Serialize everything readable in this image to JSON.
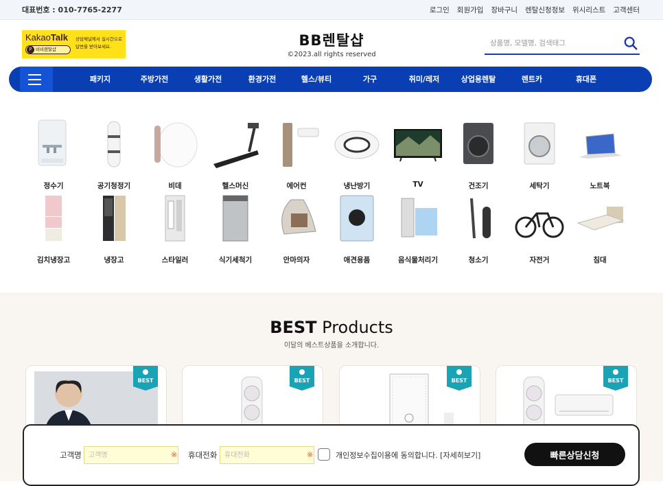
{
  "topbar": {
    "phone": "대표번호 : 010-7765-2277",
    "links": [
      "로그인",
      "회원가입",
      "장바구니",
      "렌탈신청정보",
      "위시리스트",
      "고객센터"
    ]
  },
  "header": {
    "kakao": {
      "brand_plain": "Kakao",
      "brand_bold": "Talk",
      "pill_icon": "P",
      "pill": "비비렌탈샵",
      "message": "상담채널에서 실시간으로 답변을 받아보세요."
    },
    "brand_name": "BB렌탈샵",
    "copyright": "©2023.all rights reserved",
    "search_placeholder": "상품명, 모델명, 검색태그"
  },
  "nav": {
    "items": [
      "패키지",
      "주방가전",
      "생활가전",
      "환경가전",
      "헬스/뷰티",
      "가구",
      "취미/레저",
      "상업용렌탈",
      "렌트카",
      "휴대폰"
    ]
  },
  "categories": {
    "row1": [
      "정수기",
      "공기청정기",
      "비데",
      "헬스머신",
      "에어컨",
      "냉난방기",
      "TV",
      "건조기",
      "세탁기",
      "노트북"
    ],
    "row2": [
      "김치냉장고",
      "냉장고",
      "스타일러",
      "식기세척기",
      "안마의자",
      "애견용품",
      "음식물처리기",
      "청소기",
      "자전거",
      "침대"
    ]
  },
  "best": {
    "title_bold": "BEST",
    "title_rest": " Products",
    "subtitle": "이달의 베스트상품을 소개합니다.",
    "badge": "BEST"
  },
  "form": {
    "name_label": "고객명",
    "name_placeholder": "고객명",
    "phone_label": "휴대전화",
    "phone_placeholder": "휴대전화",
    "required_mark": "※",
    "agree_text": "개인정보수집이용에 동의합니다. [자세히보기]",
    "submit_label": "빠른상담신청"
  },
  "colors": {
    "nav_bg": "#0a3fb4",
    "kakao_yellow": "#ffe11a",
    "best_bg": "#f9f6f2",
    "ribbon": "#1aa3b5"
  }
}
